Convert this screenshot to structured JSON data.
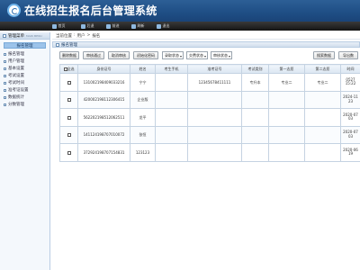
{
  "app": {
    "title": "在线招生报名后台管理系统"
  },
  "topnav": [
    {
      "label": "首页"
    },
    {
      "label": "后退"
    },
    {
      "label": "前进"
    },
    {
      "label": "刷新"
    },
    {
      "label": "退出"
    }
  ],
  "sidebar": {
    "header": "管理菜单",
    "header_en": "MAIN MENU",
    "active": "报名管理",
    "items": [
      {
        "label": "报名管理"
      },
      {
        "label": "用户管理"
      },
      {
        "label": "基本设置"
      },
      {
        "label": "考试设置"
      },
      {
        "label": "考试时间"
      },
      {
        "label": "准考证设置"
      },
      {
        "label": "数据统计"
      },
      {
        "label": "分数管理"
      }
    ]
  },
  "breadcrumb": {
    "label": "当前位置",
    "user": "用户",
    "sep": ">",
    "section": "报名"
  },
  "panel": {
    "title": "报名管理"
  },
  "toolbar": {
    "delete": "删除数据",
    "approve": "审核通过",
    "cancel": "取消审核",
    "init_password": "初始化密码",
    "filters": [
      "录取状态",
      "交费状态",
      "审核状态"
    ],
    "search": "搜索数据",
    "export": "导出数"
  },
  "table": {
    "columns": [
      "全选",
      "身份证号",
      "姓名",
      "考生手机",
      "准考证号",
      "考试类别",
      "第一志愿",
      "第二志愿",
      "时间"
    ],
    "rows": [
      {
        "id": "131002198409033216",
        "name": "宁宁",
        "phone": "",
        "ticket": "12345678411111",
        "category": "专升本",
        "first": "专业二",
        "second": "专业二",
        "time": [
          "0527",
          "15:22"
        ]
      },
      {
        "id": "420002198112306415",
        "name": "企业版",
        "phone": "",
        "ticket": "",
        "category": "",
        "first": "",
        "second": "",
        "time": [
          "2024-11",
          "23"
        ]
      },
      {
        "id": "562202198512062511",
        "name": "龙平",
        "phone": "",
        "ticket": "",
        "category": "",
        "first": "",
        "second": "",
        "time": [
          "2020-07",
          "03"
        ]
      },
      {
        "id": "141124198707010072",
        "name": "张恒",
        "phone": "",
        "ticket": "",
        "category": "",
        "first": "",
        "second": "",
        "time": [
          "2020-07",
          "03"
        ]
      },
      {
        "id": "372924198707154831",
        "name": "123123",
        "phone": "",
        "ticket": "",
        "category": "",
        "first": "",
        "second": "",
        "time": [
          "2020-06",
          "19"
        ]
      }
    ]
  },
  "colors": {
    "header": "#1f4f86",
    "nav": "#202020",
    "accent": "#9cc3ea"
  }
}
